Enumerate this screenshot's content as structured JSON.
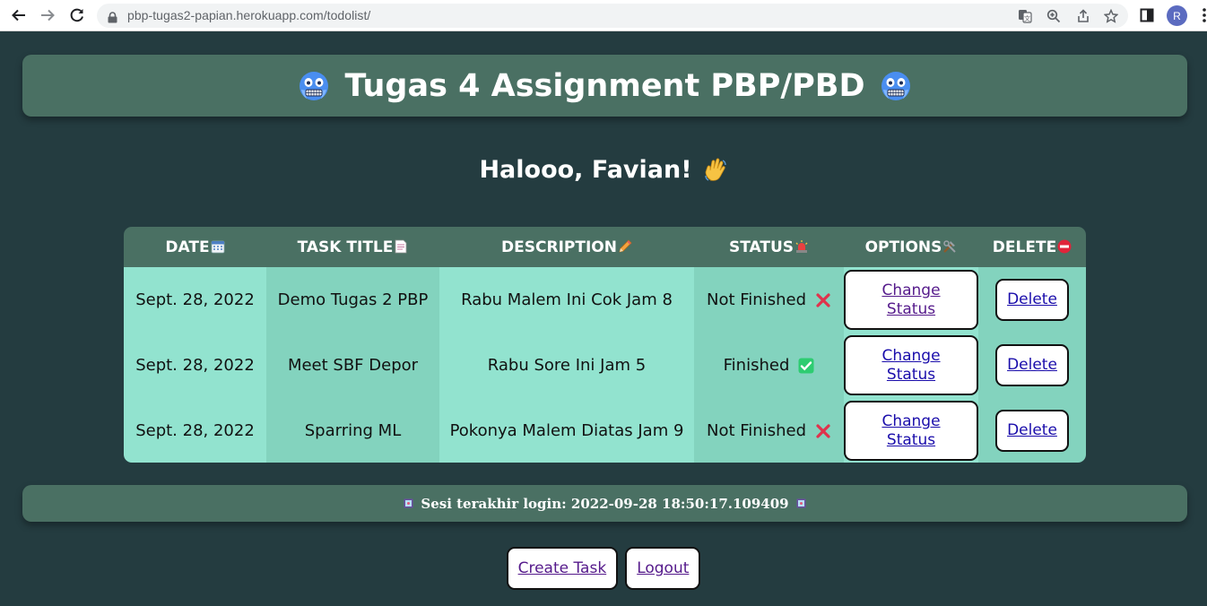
{
  "browser": {
    "url": "pbp-tugas2-papian.herokuapp.com/todolist/",
    "profile_initial": "R",
    "icons": [
      "back-icon",
      "forward-icon",
      "reload-icon",
      "lock-icon",
      "translate-icon",
      "zoom-icon",
      "share-icon",
      "bookmark-star-icon",
      "side-panel-icon",
      "menu-icon"
    ]
  },
  "header": {
    "title": "Tugas 4 Assignment PBP/PBD",
    "emoji": "cold-face-emoji"
  },
  "greeting": {
    "text": "Halooo, Favian!",
    "emoji": "waving-hand-emoji"
  },
  "table": {
    "columns": [
      {
        "label": "DATE",
        "icon": "calendar-icon"
      },
      {
        "label": "TASK TITLE",
        "icon": "page-icon"
      },
      {
        "label": "DESCRIPTION",
        "icon": "pencil-icon"
      },
      {
        "label": "STATUS",
        "icon": "siren-icon"
      },
      {
        "label": "OPTIONS",
        "icon": "tools-icon"
      },
      {
        "label": "DELETE",
        "icon": "no-entry-icon"
      }
    ],
    "rows": [
      {
        "date": "Sept. 28, 2022",
        "title": "Demo Tugas 2 PBP",
        "description": "Rabu Malem Ini Cok Jam 8",
        "status": "Not Finished",
        "status_icon": "cross-mark-icon",
        "option_label": "Change Status",
        "delete_label": "Delete"
      },
      {
        "date": "Sept. 28, 2022",
        "title": "Meet SBF Depor",
        "description": "Rabu Sore Ini Jam 5",
        "status": "Finished",
        "status_icon": "check-mark-icon",
        "option_label": "Change Status",
        "delete_label": "Delete"
      },
      {
        "date": "Sept. 28, 2022",
        "title": "Sparring ML",
        "description": "Pokonya Malem Diatas Jam 9",
        "status": "Not Finished",
        "status_icon": "cross-mark-icon",
        "option_label": "Change Status",
        "delete_label": "Delete"
      }
    ]
  },
  "footer": {
    "text": "Sesi terakhir login: 2022-09-28 18:50:17.109409",
    "icon": "tv-icon"
  },
  "actions": {
    "create_label": "Create Task",
    "logout_label": "Logout"
  },
  "colors": {
    "page_bg": "#243c40",
    "card_bg": "#4a7063",
    "cell_light": "#92e3cf",
    "cell_dark": "#83d3be",
    "cross": "#e0324c",
    "check": "#2ecc71"
  }
}
